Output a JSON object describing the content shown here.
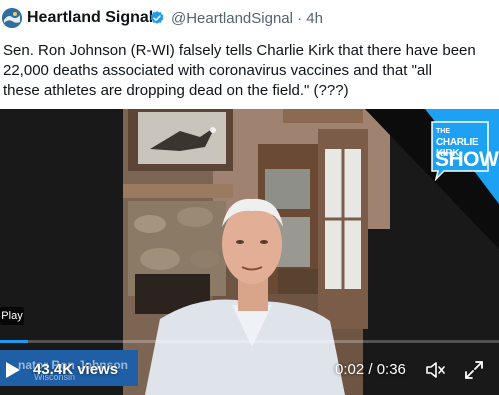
{
  "tweet": {
    "display_name": "Heartland Signal",
    "handle_line": "@HeartlandSignal · 4h",
    "verified_icon": "verified-badge-icon",
    "avatar_icon": "heartland-signal-logo-icon",
    "text": "Sen. Ron Johnson (R-WI) falsely tells Charlie Kirk that there have been\n22,000 deaths associated with coronavirus vaccines and that \"all\nthese athletes are dropping dead on the field.\" (???)"
  },
  "video": {
    "show_logo": {
      "line1": "THE",
      "line2": "CHARLIE KIRK",
      "line3": "SHOW"
    },
    "play_badge": "Play",
    "lower_third": {
      "name": "nator Ron Johnson",
      "subtitle": "Wisconsin"
    },
    "views": "43.4K views",
    "time": "0:02 / 0:36",
    "progress_fraction": 0.056,
    "icons": {
      "play": "play-icon",
      "volume": "volume-icon",
      "fullscreen": "fullscreen-icon"
    },
    "colors": {
      "accent": "#1d9bf0",
      "lower_third": "#1f5fa6",
      "logo_blue": "#1da1f2"
    }
  }
}
